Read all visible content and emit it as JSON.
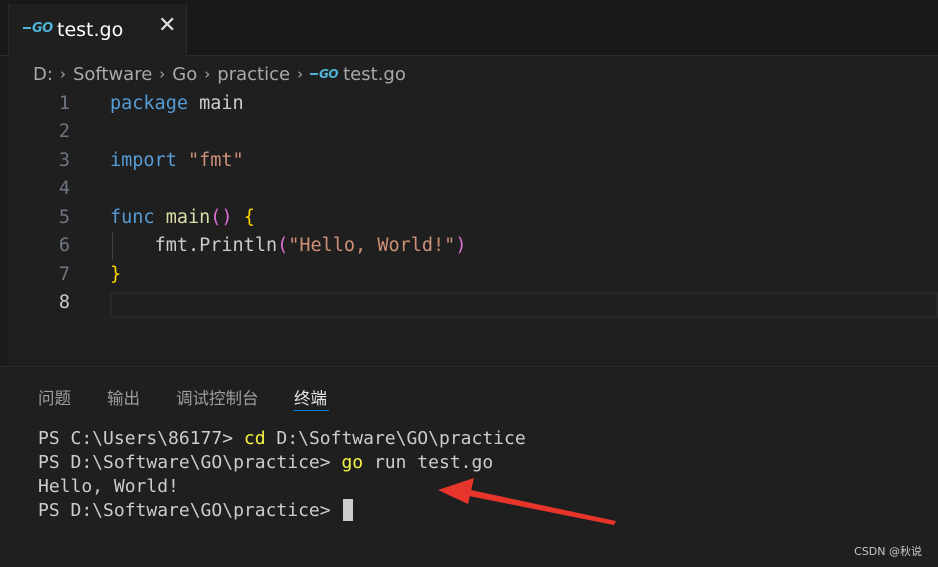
{
  "tab": {
    "file_name": "test.go",
    "close_glyph": "✕",
    "icon": "go-file-icon"
  },
  "breadcrumb": {
    "items": [
      "D:",
      "Software",
      "Go",
      "practice"
    ],
    "file": "test.go",
    "separator": "›"
  },
  "editor": {
    "line_numbers": [
      "1",
      "2",
      "3",
      "4",
      "5",
      "6",
      "7",
      "8"
    ],
    "active_line": "8",
    "code": {
      "l1_kw": "package",
      "l1_name": "main",
      "l3_kw": "import",
      "l3_str": "\"fmt\"",
      "l5_kw": "func",
      "l5_fn": "main",
      "l5_parens": "()",
      "l5_brace": "{",
      "l6_pkg": "fmt",
      "l6_dot": ".",
      "l6_fn": "Println",
      "l6_open": "(",
      "l6_str": "\"Hello, World!\"",
      "l6_close": ")",
      "l7_brace": "}"
    }
  },
  "panel": {
    "tabs": [
      "问题",
      "输出",
      "调试控制台",
      "终端"
    ],
    "active_tab": "终端"
  },
  "terminal": {
    "line1_prompt": "PS C:\\Users\\86177> ",
    "line1_cmd": "cd",
    "line1_arg": " D:\\Software\\GO\\practice",
    "line2_prompt": "PS D:\\Software\\GO\\practice> ",
    "line2_cmd": "go",
    "line2_arg": " run test.go",
    "line3_output": "Hello, World!",
    "line4_prompt": "PS D:\\Software\\GO\\practice> "
  },
  "watermark": "CSDN @秋说",
  "colors": {
    "annotation_arrow": "#e8352b",
    "go_brand": "#4fb3d6",
    "active_tab_underline": "#0078d4"
  }
}
